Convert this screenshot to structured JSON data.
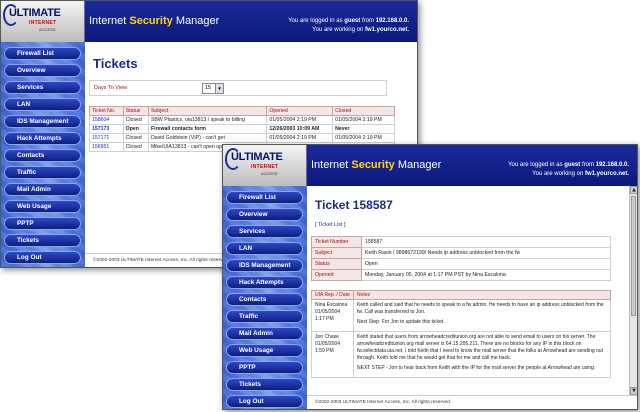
{
  "brand": {
    "logo_main": "ULTIMATE",
    "logo_sub": "INTERNET",
    "logo_sub2": "ACCESS",
    "title_prefix": "Internet ",
    "title_highlight": "Security",
    "title_suffix": " Manager",
    "login_line1_pre": "You are logged in as ",
    "login_user": "guest",
    "login_line1_mid": " from ",
    "login_ip": "192.168.0.0.",
    "login_line2_pre": "You are working on ",
    "login_host": "fw1.yourco.net."
  },
  "nav": {
    "firewall_list": "Firewall List",
    "overview": "Overview",
    "services": "Services",
    "lan": "LAN",
    "ids_management": "IDS Management",
    "hack_attempts": "Hack Attempts",
    "contacts": "Contacts",
    "traffic": "Traffic",
    "mail_admin": "Mail Admin",
    "web_usage": "Web Usage",
    "pptp": "PPTP",
    "tickets": "Tickets",
    "log_out": "Log Out"
  },
  "footer": "©2002-2003 ULTIMATE Internet Access, Inc. All rights reserved.",
  "tickets_page": {
    "title": "Tickets",
    "days_label": "Days To View",
    "days_value": "15",
    "columns": [
      "Ticket No.",
      "Status",
      "Subject",
      "Opened",
      "Closed"
    ],
    "rows": [
      [
        "158604",
        "Closed",
        "SBW Plastics, uia13813 / speak to billing",
        "01/05/2004 2:19 PM",
        "01/05/2004 2:19 PM"
      ],
      [
        "157173",
        "Open",
        "Firewall contacts form",
        "12/26/2003 10:09 AM",
        "Never"
      ],
      [
        "157171",
        "Closed",
        "David Goldstein (VIP) - can't get",
        "01/05/2004 2:19 PM",
        "01/05/2004 2:19 PM"
      ],
      [
        "156951",
        "Closed",
        "Mike/UIA13813 - can't open up D",
        "",
        ""
      ]
    ]
  },
  "ticket_detail": {
    "title": "Ticket 158587",
    "back_link": "Ticket List",
    "fields": [
      {
        "label": "Ticket Number",
        "value": "158587"
      },
      {
        "label": "Subject",
        "value": "Keith Rasin / 9898672199/ Needs ip address unblocked from the fw"
      },
      {
        "label": "Status",
        "value": "Open"
      },
      {
        "label": "Opened",
        "value": "Monday, January 05, 2004 at 1:17 PM PST by Nina Escalona"
      }
    ],
    "notes_columns": [
      "UIA Rep. / Date",
      "Notes"
    ],
    "notes": [
      {
        "who": "Nina Escalona",
        "date": "01/05/2004",
        "time": "1:17 PM",
        "paras": [
          "Keith called and said that he needs to speak to a fw admin. He needs to have an ip address unblocked from the fw. Call was transferred to Jon.",
          "Next Step: For Jon to update this ticket."
        ]
      },
      {
        "who": "Jon Chase",
        "date": "01/05/2004",
        "time": "1:59 PM",
        "paras": [
          "Keith stated that users from arrowheadcreditunion.org are not able to send email to users on his server. The arrowheadcreditunion.org mail server is 64.15.205.211. There are no blocks for any IP in this block on fw.selectdata.uia.net. I told Keith that I need to know the mail server that the folks at Arrowhead are sending out through. Keith told me that he would get that for me and call me back.",
          "NEXT STEP - Jon to hear back from Keith with the IP for the mail server the people at Arrowhead are using."
        ]
      }
    ]
  }
}
